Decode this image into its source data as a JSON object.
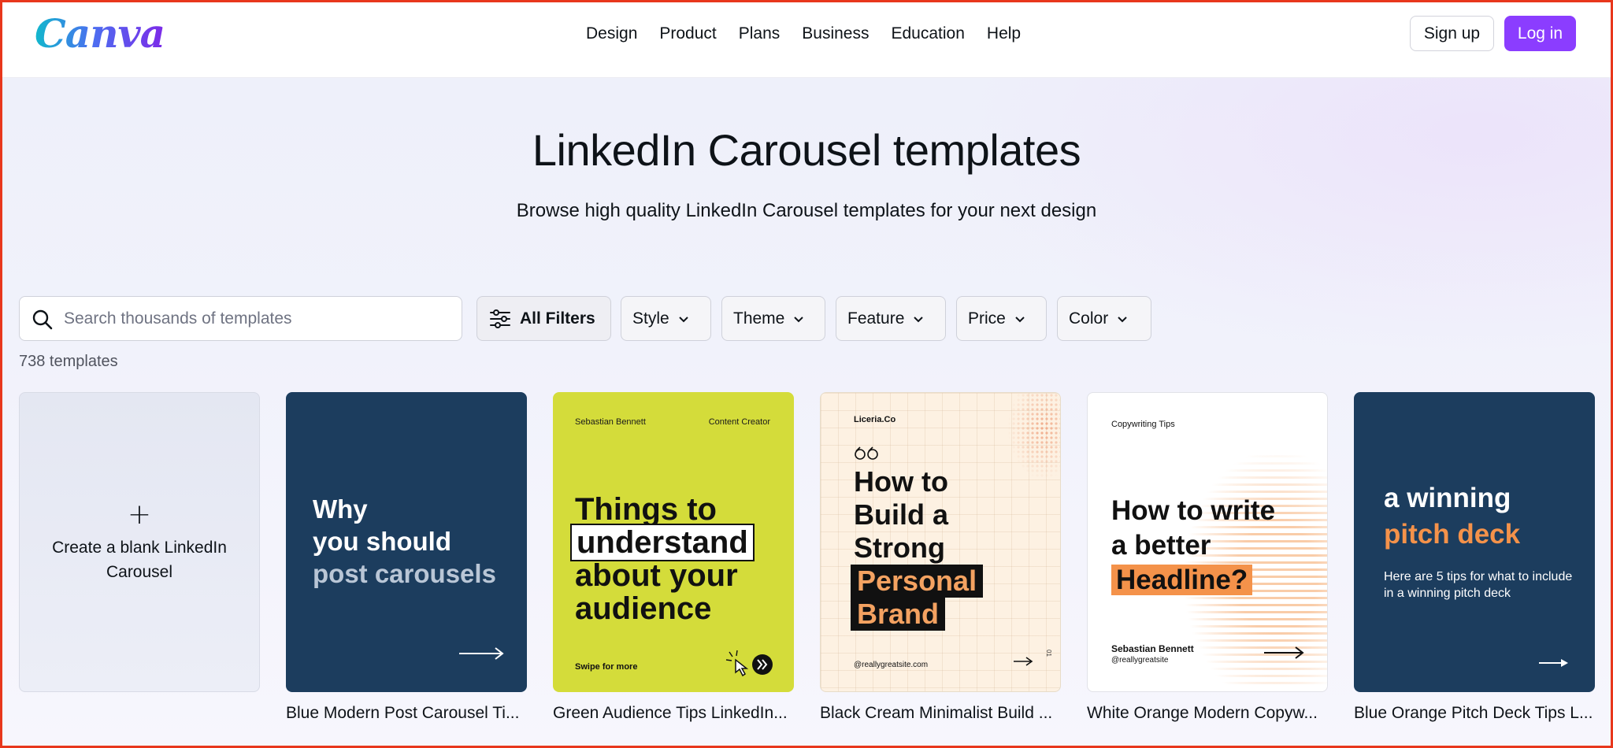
{
  "header": {
    "logo": "Canva",
    "nav": [
      "Design",
      "Product",
      "Plans",
      "Business",
      "Education",
      "Help"
    ],
    "signup_label": "Sign up",
    "login_label": "Log in"
  },
  "hero": {
    "title": "LinkedIn Carousel templates",
    "subtitle": "Browse high quality LinkedIn Carousel templates for your next design"
  },
  "search": {
    "placeholder": "Search thousands of templates"
  },
  "filters": {
    "all_label": "All Filters",
    "style": "Style",
    "theme": "Theme",
    "feature": "Feature",
    "price": "Price",
    "color": "Color"
  },
  "results": {
    "count": "738 templates"
  },
  "cards": {
    "blank": {
      "label": "Create a blank LinkedIn Carousel"
    },
    "c1": {
      "line1": "Why",
      "line2": "you should",
      "line3": "post carousels",
      "name": "Blue Modern Post Carousel Ti..."
    },
    "c2": {
      "author": "Sebastian Bennett",
      "role": "Content Creator",
      "line1": "Things to",
      "line2": "understand",
      "line3": "about your",
      "line4": "audience",
      "swipe": "Swipe for more",
      "name": "Green Audience Tips LinkedIn..."
    },
    "c3": {
      "brand": "Liceria.Co",
      "line1": "How to",
      "line2": "Build a",
      "line3": "Strong",
      "line4": "Personal",
      "line5": "Brand",
      "site": "@reallygreatsite.com",
      "side": "01",
      "name": "Black Cream Minimalist Build ..."
    },
    "c4": {
      "label": "Copywriting Tips",
      "line1": "How to write",
      "line2": "a better",
      "line3": "Headline?",
      "author": "Sebastian Bennett",
      "handle": "@reallygreatsite",
      "name": "White Orange Modern Copyw..."
    },
    "c5": {
      "line1": "a winning",
      "line2": "pitch deck",
      "sub": "Here are 5 tips for what to include in a winning pitch deck",
      "name": "Blue Orange Pitch Deck Tips L..."
    }
  },
  "colors": {
    "brand_purple": "#8b3dff",
    "navy": "#1c3d5e",
    "lime": "#d4dc3a",
    "orange": "#f4924a"
  }
}
